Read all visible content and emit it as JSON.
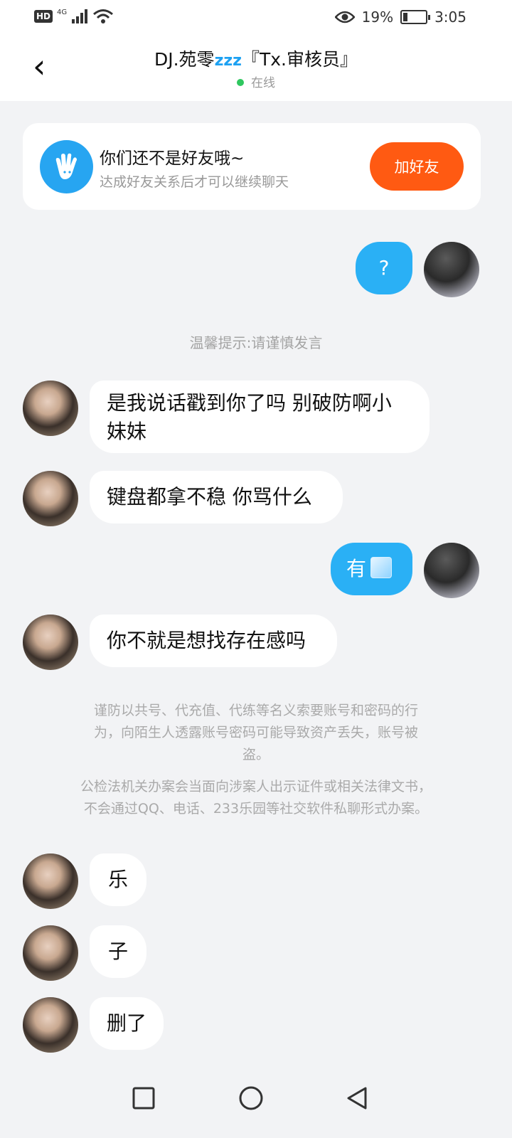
{
  "status_bar": {
    "hd": "HD",
    "network": "4G",
    "battery": "19%",
    "battery_level": 0.19,
    "time": "3:05"
  },
  "header": {
    "back_icon": "chevron-left-icon",
    "title": "DJ.苑零",
    "title_icon": "zzz",
    "title_suffix": "『Tx.审核员』",
    "status": "在线"
  },
  "friend_card": {
    "icon": "hand-wave-icon",
    "title": "你们还不是好友哦~",
    "subtitle": "达成好友关系后才可以继续聊天",
    "button": "加好友"
  },
  "messages": [
    {
      "from": "me",
      "text": "?"
    },
    {
      "from": "system",
      "text": "温馨提示:请谨慎发言"
    },
    {
      "from": "other",
      "text_line1": "是我说话戳到你了吗 别破防啊小",
      "text_line2": "妹妹"
    },
    {
      "from": "other",
      "text": "键盘都拿不稳 你骂什么"
    },
    {
      "from": "me",
      "text": "有",
      "emoji": "ice-cube-icon"
    },
    {
      "from": "other",
      "text": "你不就是想找存在感吗"
    },
    {
      "from": "system",
      "line1": "谨防以共号、代充值、代练等名义索要账号和密码的行",
      "line2": "为，向陌生人透露账号密码可能导致资产丢失，账号被",
      "line3": "盗。",
      "line4": "公检法机关办案会当面向涉案人出示证件或相关法律文书，",
      "line5": "不会通过QQ、电话、233乐园等社交软件私聊形式办案。"
    },
    {
      "from": "other",
      "text": "乐"
    },
    {
      "from": "other",
      "text": "子"
    },
    {
      "from": "other",
      "text": "删了"
    }
  ],
  "nav": {
    "recent": "square-icon",
    "home": "circle-icon",
    "back": "triangle-back-icon"
  }
}
